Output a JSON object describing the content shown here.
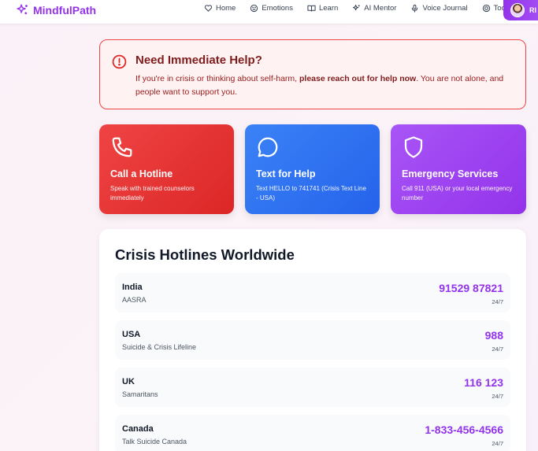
{
  "nav": {
    "brand": "MindfulPath",
    "links": [
      {
        "label": "Home",
        "icon": "heart-icon"
      },
      {
        "label": "Emotions",
        "icon": "smile-icon"
      },
      {
        "label": "Learn",
        "icon": "book-icon"
      },
      {
        "label": "AI Mentor",
        "icon": "sparkles-icon"
      },
      {
        "label": "Voice Journal",
        "icon": "mic-icon"
      },
      {
        "label": "Tools",
        "icon": "globe-icon",
        "caret": "▼"
      }
    ],
    "user_initials": "RI"
  },
  "alert": {
    "title": "Need Immediate Help?",
    "text_before": "If you're in crisis or thinking about self-harm, ",
    "text_bold": "please reach out for help now",
    "text_after": ". You are not alone, and people want to support you."
  },
  "cards": [
    {
      "title": "Call a Hotline",
      "desc": "Speak with trained counselors immediately",
      "icon": "phone-icon",
      "color": "#dc2626"
    },
    {
      "title": "Text for Help",
      "desc": "Text HELLO to 741741 (Crisis Text Line - USA)",
      "icon": "message-circle-icon",
      "color": "#2563eb"
    },
    {
      "title": "Emergency Services",
      "desc": "Call 911 (USA) or your local emergency number",
      "icon": "shield-icon",
      "color": "#9333ea"
    }
  ],
  "hotlines": {
    "title": "Crisis Hotlines Worldwide",
    "rows": [
      {
        "country": "India",
        "org": "AASRA",
        "number": "91529 87821",
        "availability": "24/7"
      },
      {
        "country": "USA",
        "org": "Suicide & Crisis Lifeline",
        "number": "988",
        "availability": "24/7"
      },
      {
        "country": "UK",
        "org": "Samaritans",
        "number": "116 123",
        "availability": "24/7"
      },
      {
        "country": "Canada",
        "org": "Talk Suicide Canada",
        "number": "1-833-456-4566",
        "availability": "24/7"
      }
    ]
  },
  "colors": {
    "brand": "#9333ea",
    "alert_border": "#ef4444",
    "alert_bg": "#fef2f2"
  }
}
